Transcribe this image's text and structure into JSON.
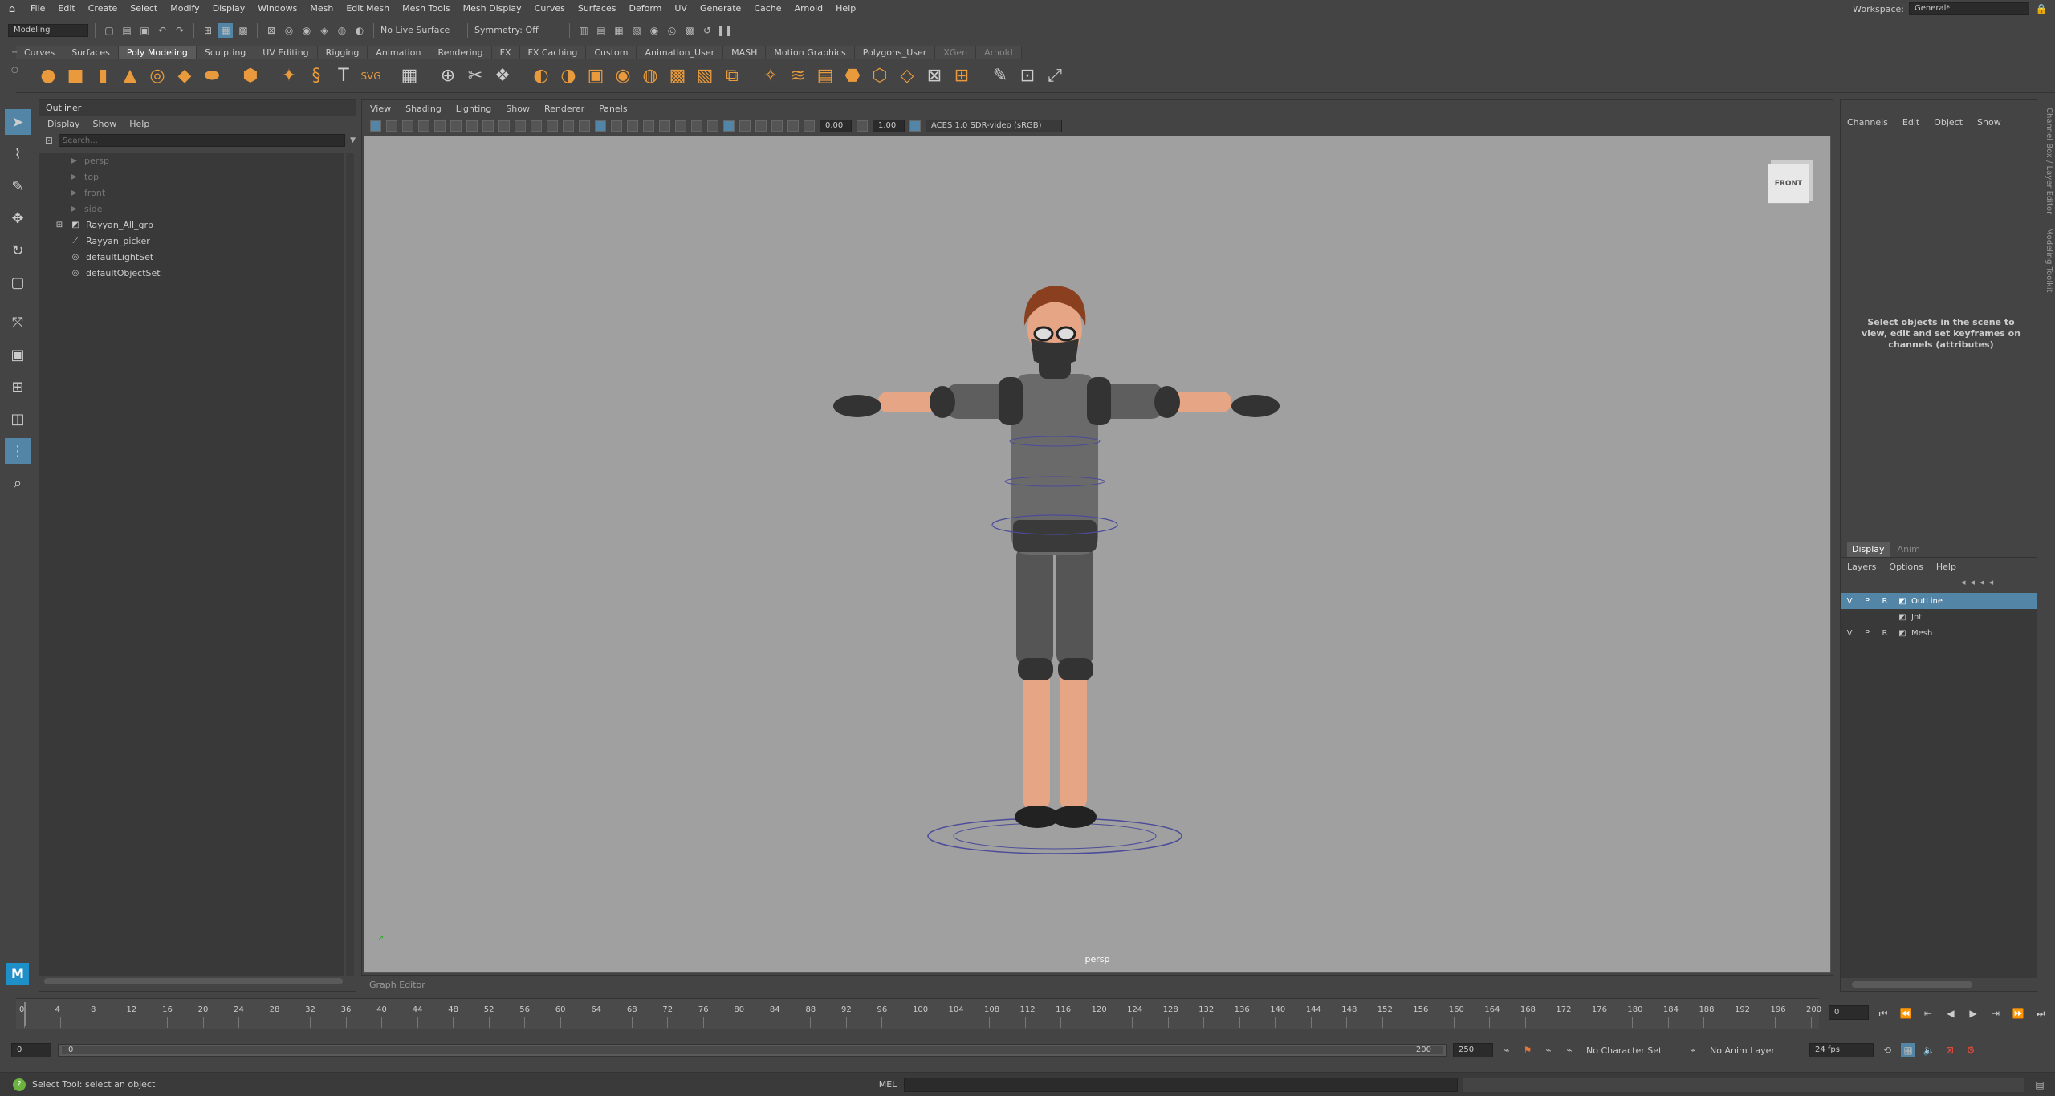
{
  "menubar": {
    "items": [
      "File",
      "Edit",
      "Create",
      "Select",
      "Modify",
      "Display",
      "Windows",
      "Mesh",
      "Edit Mesh",
      "Mesh Tools",
      "Mesh Display",
      "Curves",
      "Surfaces",
      "Deform",
      "UV",
      "Generate",
      "Cache",
      "Arnold",
      "Help"
    ],
    "workspace_label": "Workspace:",
    "workspace_value": "General*"
  },
  "statusline": {
    "menuset": "Modeling",
    "live_surface": "No Live Surface",
    "symmetry": "Symmetry: Off"
  },
  "shelf": {
    "tabs": [
      "Curves",
      "Surfaces",
      "Poly Modeling",
      "Sculpting",
      "UV Editing",
      "Rigging",
      "Animation",
      "Rendering",
      "FX",
      "FX Caching",
      "Custom",
      "Animation_User",
      "MASH",
      "Motion Graphics",
      "Polygons_User",
      "XGen",
      "Arnold"
    ],
    "active_tab": "Poly Modeling"
  },
  "outliner": {
    "title": "Outliner",
    "menu": [
      "Display",
      "Show",
      "Help"
    ],
    "search_placeholder": "Search...",
    "items": [
      {
        "label": "persp",
        "dim": true
      },
      {
        "label": "top",
        "dim": true
      },
      {
        "label": "front",
        "dim": true
      },
      {
        "label": "side",
        "dim": true
      },
      {
        "label": "Rayyan_All_grp",
        "dim": false
      },
      {
        "label": "Rayyan_picker",
        "dim": false
      },
      {
        "label": "defaultLightSet",
        "dim": false
      },
      {
        "label": "defaultObjectSet",
        "dim": false
      }
    ]
  },
  "viewport": {
    "menu": [
      "View",
      "Shading",
      "Lighting",
      "Show",
      "Renderer",
      "Panels"
    ],
    "exposure": "0.00",
    "gamma": "1.00",
    "colorspace": "ACES 1.0 SDR-video (sRGB)",
    "viewcube_label": "FRONT",
    "camera_label": "persp",
    "graph_editor_label": "Graph Editor"
  },
  "channelbox": {
    "menu": [
      "Channels",
      "Edit",
      "Object",
      "Show"
    ],
    "message": "Select objects in the scene to view, edit and set keyframes on channels (attributes)",
    "side_tab_1": "Channel Box / Layer Editor",
    "side_tab_2": "Modeling Toolkit"
  },
  "layers": {
    "tabs": [
      "Display",
      "Anim"
    ],
    "menu": [
      "Layers",
      "Options",
      "Help"
    ],
    "items": [
      {
        "v": "V",
        "p": "P",
        "r": "R",
        "name": "OutLine",
        "selected": true
      },
      {
        "v": "",
        "p": "",
        "r": "",
        "name": "Jnt",
        "selected": false
      },
      {
        "v": "V",
        "p": "P",
        "r": "R",
        "name": "Mesh",
        "selected": false
      }
    ]
  },
  "timeslider": {
    "ticks": [
      "0",
      "4",
      "8",
      "12",
      "16",
      "20",
      "24",
      "28",
      "32",
      "36",
      "40",
      "44",
      "48",
      "52",
      "56",
      "60",
      "64",
      "68",
      "72",
      "76",
      "80",
      "84",
      "88",
      "92",
      "96",
      "100",
      "104",
      "108",
      "112",
      "116",
      "120",
      "124",
      "128",
      "132",
      "136",
      "140",
      "144",
      "148",
      "152",
      "156",
      "160",
      "164",
      "168",
      "172",
      "176",
      "180",
      "184",
      "188",
      "192",
      "196",
      "200"
    ],
    "current_frame": "0"
  },
  "rangeslider": {
    "start": "0",
    "anim_start": "0",
    "range_end": "200",
    "anim_end": "250",
    "character_set": "No Character Set",
    "anim_layer": "No Anim Layer",
    "fps": "24 fps"
  },
  "commandline": {
    "help_text": "Select Tool: select an object",
    "mel_label": "MEL"
  },
  "colors": {
    "accent": "#5285a6",
    "shelf_orange": "#e89a3c",
    "viewport_bg": "#a0a0a0"
  }
}
